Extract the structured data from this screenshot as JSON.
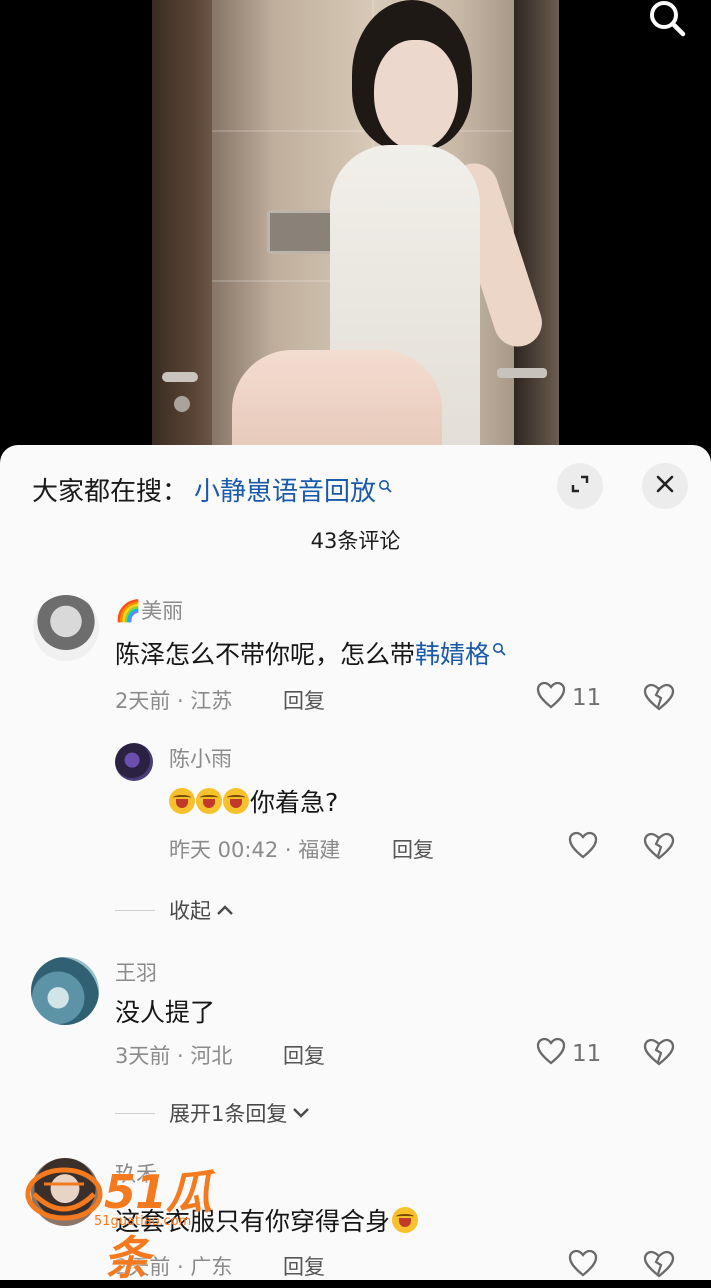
{
  "video": {
    "search_icon": "search-icon"
  },
  "header": {
    "hot_search_label": "大家都在搜：",
    "hot_search_term": "小静崽语音回放",
    "comment_count": "43条评论"
  },
  "comments": [
    {
      "name": "美丽",
      "name_prefix_emoji": "🌈",
      "text": "陈泽怎么不带你呢，怎么带",
      "linked_term": "韩婧格",
      "time": "2天前",
      "location": "江苏",
      "reply_label": "回复",
      "likes": "11"
    },
    {
      "name": "陈小雨",
      "text": "你着急?",
      "emoji_count": 3,
      "time": "昨天 00:42",
      "location": "福建",
      "reply_label": "回复",
      "likes": ""
    },
    {
      "name": "王羽",
      "text": "没人提了",
      "time": "3天前",
      "location": "河北",
      "reply_label": "回复",
      "likes": "11"
    },
    {
      "name": "玖禾",
      "text": "这套衣服只有你穿得合身",
      "time": "2天前",
      "location": "广东",
      "reply_label": "回复",
      "likes": ""
    }
  ],
  "toggles": {
    "collapse": "收起",
    "expand": "展开1条回复"
  },
  "watermark": {
    "text": "51瓜条",
    "sub": "51guatiao.com"
  },
  "colors": {
    "link": "#1b5aa8",
    "sheet_bg": "#fafafa",
    "meta_gray": "#8b8b8b"
  }
}
